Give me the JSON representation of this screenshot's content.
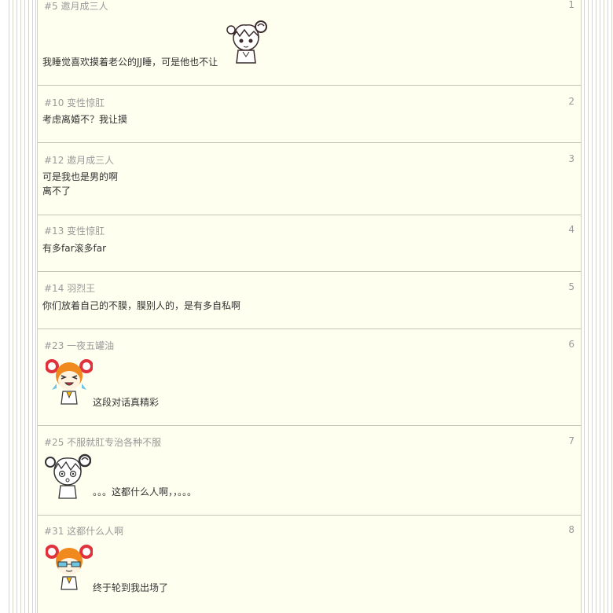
{
  "thread": {
    "posts": [
      {
        "floor_no": "#5",
        "author": "邀月成三人",
        "index": "1",
        "lines": [
          "我睡觉喜欢摸着老公的JJ睡，可是他也不让"
        ],
        "emoji": "sticker-outline-girl-icon"
      },
      {
        "floor_no": "#10",
        "author": "变性惊肛",
        "index": "2",
        "lines": [
          "考虑离婚不？我让摸"
        ]
      },
      {
        "floor_no": "#12",
        "author": "邀月成三人",
        "index": "3",
        "lines": [
          "可是我也是男的啊",
          "离不了"
        ]
      },
      {
        "floor_no": "#13",
        "author": "变性惊肛",
        "index": "4",
        "lines": [
          "有多far滚多far"
        ]
      },
      {
        "floor_no": "#14",
        "author": "羽烈王",
        "index": "5",
        "lines": [
          "你们放着自己的不膜，膜别人的，是有多自私啊"
        ]
      },
      {
        "floor_no": "#23",
        "author": "一夜五罐油",
        "index": "6",
        "lines": [
          "这段对话真精彩"
        ],
        "emoji": "sticker-orange-girl-laughing-icon"
      },
      {
        "floor_no": "#25",
        "author": "不服就肛专治各种不服",
        "index": "7",
        "lines": [
          "。。。这都什么人啊，，。。。"
        ],
        "emoji": "sticker-outline-girl-shocked-icon"
      },
      {
        "floor_no": "#31",
        "author": "这都什么人啊",
        "index": "8",
        "lines": [
          "终于轮到我出场了"
        ],
        "emoji": "sticker-orange-girl-sunglasses-icon"
      }
    ]
  },
  "colors": {
    "panel_bg": "#fffff0",
    "meta_text": "#9a9a9a",
    "body_text": "#333333",
    "divider": "#c6c6b8",
    "sticker_orange": "#f08a1e",
    "sticker_red": "#e0323c"
  }
}
